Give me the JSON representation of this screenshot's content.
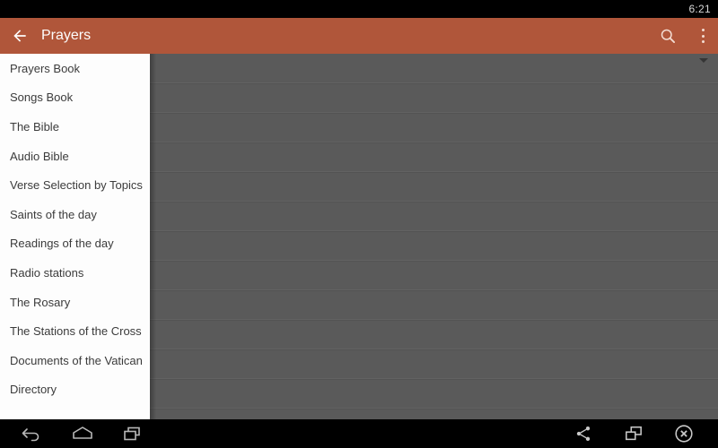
{
  "status_bar": {
    "clock": "6:21"
  },
  "app_bar": {
    "back_icon": "arrow-left-icon",
    "title": "Prayers",
    "search_icon": "search-icon",
    "overflow_icon": "overflow-menu-icon",
    "background_color": "#b0563a",
    "text_color": "#fdfdfd"
  },
  "drawer": {
    "background_color": "#fdfdfd",
    "text_color": "#3b3b3b",
    "items": [
      {
        "label": "Prayers Book"
      },
      {
        "label": "Songs Book"
      },
      {
        "label": "The Bible"
      },
      {
        "label": "Audio Bible"
      },
      {
        "label": "Verse Selection by Topics"
      },
      {
        "label": "Saints of the day"
      },
      {
        "label": "Readings of the day"
      },
      {
        "label": "Radio stations"
      },
      {
        "label": "The Rosary"
      },
      {
        "label": "The Stations of the Cross"
      },
      {
        "label": "Documents of the Vatican"
      },
      {
        "label": "Directory"
      },
      {
        "label": ""
      }
    ]
  },
  "content": {
    "scrim_color": "#5a5a5a",
    "spinner_caret_icon": "chevron-down-icon",
    "row_count": 12
  },
  "nav_bar": {
    "background_color": "#000000",
    "keys": [
      {
        "name": "back-nav-icon"
      },
      {
        "name": "home-nav-icon"
      },
      {
        "name": "recents-nav-icon"
      }
    ],
    "actions": [
      {
        "name": "share-icon"
      },
      {
        "name": "screenshot-icon"
      },
      {
        "name": "close-icon"
      }
    ]
  }
}
